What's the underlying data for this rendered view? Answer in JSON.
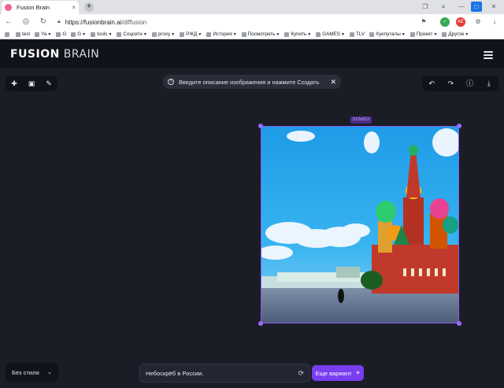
{
  "browser": {
    "tab_title": "Fusion Brain",
    "tab_close": "×",
    "new_tab": "+",
    "url_host": "https://fusionbrain.ai",
    "url_path": "/diffusion",
    "ext_label": "AE",
    "bookmarks": [
      {
        "label": "",
        "caret": false
      },
      {
        "label": "test",
        "caret": false
      },
      {
        "label": "Ya",
        "caret": true
      },
      {
        "label": "G",
        "caret": false
      },
      {
        "label": "G",
        "caret": true
      },
      {
        "label": "tools",
        "caret": true
      },
      {
        "label": "Соцсети",
        "caret": true
      },
      {
        "label": "proxy",
        "caret": true
      },
      {
        "label": "РЖД",
        "caret": true
      },
      {
        "label": "История",
        "caret": true
      },
      {
        "label": "Посмотреть",
        "caret": true
      },
      {
        "label": "Купить",
        "caret": true
      },
      {
        "label": "GAMES",
        "caret": true
      },
      {
        "label": "TLV",
        "caret": false
      },
      {
        "label": "Хуепуталы",
        "caret": true
      },
      {
        "label": "Проект",
        "caret": true
      },
      {
        "label": "Другое",
        "caret": true
      }
    ]
  },
  "app": {
    "logo_bold": "FUSION",
    "logo_light": "BRAIN",
    "hint_text": "Введите описание изображения и нажмите Создать",
    "size_badge": "512x512",
    "style_label": "Без стиля",
    "prompt_text": "Небоскрёб в России.",
    "generate_label": "Еще вариант"
  },
  "colors": {
    "accent": "#7a3df0",
    "selection": "#8b5cf6",
    "app_bg": "#1b1d26",
    "panel_bg": "#11131a"
  }
}
